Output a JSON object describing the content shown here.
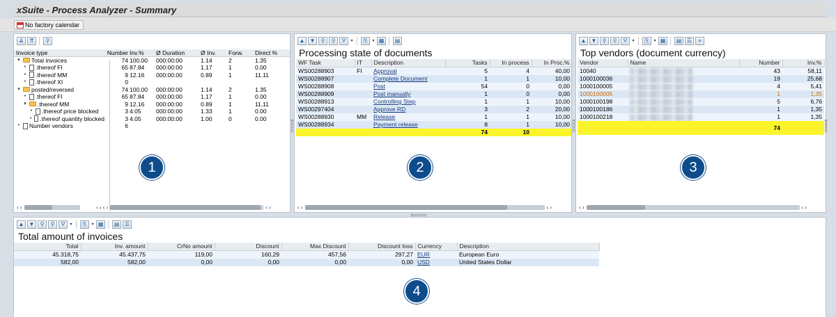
{
  "window": {
    "title": "xSuite - Process Analyzer - Summary"
  },
  "appbar": {
    "calendar_button": "No factory calendar"
  },
  "panel1": {
    "columns": [
      "Invoice type",
      "Number",
      "Inv.%",
      "Ø Duration",
      "Ø Inv.",
      "Forw.",
      "Direct %"
    ],
    "rows": [
      {
        "level": 0,
        "icon": "folder",
        "expand": "▾",
        "name": "Total invoices",
        "number": "74",
        "inv": "100.00",
        "duration": "000:00:00",
        "avg": "1.14",
        "forw": "2",
        "direct": "1.35"
      },
      {
        "level": 1,
        "icon": "doc",
        "expand": "•",
        "name": ".thereof FI",
        "number": "65",
        "inv": "87.84",
        "duration": "000:00:00",
        "avg": "1.17",
        "forw": "1",
        "direct": "0.00"
      },
      {
        "level": 1,
        "icon": "doc",
        "expand": "•",
        "name": ".thereof MM",
        "number": "9",
        "inv": "12.16",
        "duration": "000:00:00",
        "avg": "0.89",
        "forw": "1",
        "direct": "11.11"
      },
      {
        "level": 1,
        "icon": "doc",
        "expand": "•",
        "name": ".thereof XI",
        "number": "0",
        "inv": "",
        "duration": "",
        "avg": "",
        "forw": "",
        "direct": ""
      },
      {
        "level": 0,
        "icon": "folder",
        "expand": "▾",
        "name": "posted/reversed",
        "number": "74",
        "inv": "100.00",
        "duration": "000:00:00",
        "avg": "1.14",
        "forw": "2",
        "direct": "1.35"
      },
      {
        "level": 1,
        "icon": "doc",
        "expand": "•",
        "name": ".thereof FI",
        "number": "65",
        "inv": "87.84",
        "duration": "000:00:00",
        "avg": "1.17",
        "forw": "1",
        "direct": "0.00"
      },
      {
        "level": 1,
        "icon": "folder",
        "expand": "▾",
        "name": ".thereof MM",
        "number": "9",
        "inv": "12.16",
        "duration": "000:00:00",
        "avg": "0.89",
        "forw": "1",
        "direct": "11.11"
      },
      {
        "level": 2,
        "icon": "doc",
        "expand": "•",
        "name": ".thereof price blocked",
        "number": "3",
        "inv": "4.05",
        "duration": "000:00:00",
        "avg": "1.33",
        "forw": "1",
        "direct": "0.00"
      },
      {
        "level": 2,
        "icon": "doc",
        "expand": "•",
        "name": ".thereof quantity blocked",
        "number": "3",
        "inv": "4.05",
        "duration": "000:00:00",
        "avg": "1.00",
        "forw": "0",
        "direct": "0.00"
      },
      {
        "level": 0,
        "icon": "doc",
        "expand": "•",
        "name": "Number vendors",
        "number": "6",
        "inv": "",
        "duration": "",
        "avg": "",
        "forw": "",
        "direct": ""
      }
    ],
    "badge": "1"
  },
  "panel2": {
    "title": "Processing state of documents",
    "columns": [
      "WF Task",
      "IT",
      "Description",
      "Tasks",
      "In process",
      "In Proc.%"
    ],
    "rows": [
      {
        "task": "WS00288903",
        "it": "FI",
        "desc": "Approval",
        "tasks": "5",
        "inproc": "4",
        "pct": "40,00"
      },
      {
        "task": "WS00288907",
        "it": "",
        "desc": "Complete Document",
        "tasks": "1",
        "inproc": "1",
        "pct": "10,00"
      },
      {
        "task": "WS00288908",
        "it": "",
        "desc": "Post",
        "tasks": "54",
        "inproc": "0",
        "pct": "0,00"
      },
      {
        "task": "WS00288909",
        "it": "",
        "desc": "Post manually",
        "tasks": "1",
        "inproc": "0",
        "pct": "0,00"
      },
      {
        "task": "WS00288913",
        "it": "",
        "desc": "Controlling Step",
        "tasks": "1",
        "inproc": "1",
        "pct": "10,00"
      },
      {
        "task": "WS00297404",
        "it": "",
        "desc": "Approve RD",
        "tasks": "3",
        "inproc": "2",
        "pct": "20,00"
      },
      {
        "task": "WS00288930",
        "it": "MM",
        "desc": "Release",
        "tasks": "1",
        "inproc": "1",
        "pct": "10,00"
      },
      {
        "task": "WS00288934",
        "it": "",
        "desc": "Payment release",
        "tasks": "8",
        "inproc": "1",
        "pct": "10,00"
      }
    ],
    "sum": {
      "tasks": "74",
      "inproc": "10"
    },
    "badge": "2"
  },
  "panel3": {
    "title": "Top vendors (document currency)",
    "columns": [
      "Vendor",
      "Name",
      "Number",
      "Inv.%"
    ],
    "rows": [
      {
        "vendor": "10040",
        "number": "43",
        "pct": "58,11"
      },
      {
        "vendor": "1000100036",
        "number": "19",
        "pct": "25,68"
      },
      {
        "vendor": "1000100005",
        "number": "4",
        "pct": "5,41"
      },
      {
        "vendor": "1000100005",
        "number": "1",
        "pct": "1,35"
      },
      {
        "vendor": "1000100198",
        "number": "5",
        "pct": "6,76"
      },
      {
        "vendor": "1000100186",
        "number": "1",
        "pct": "1,35"
      },
      {
        "vendor": "1000100218",
        "number": "1",
        "pct": "1,35"
      }
    ],
    "sum": {
      "number": "74"
    },
    "highlight_color": "#c86a00",
    "badge": "3"
  },
  "panel4": {
    "title": "Total amount of invoices",
    "columns": [
      "Total",
      "Inv. amount",
      "CrNo amount",
      "Discount",
      "Max Discount",
      "Discount loss",
      "Currency",
      "Description"
    ],
    "rows": [
      {
        "total": "45.318,75",
        "inv": "45.437,75",
        "crno": "119,00",
        "disc": "160,29",
        "maxdisc": "457,56",
        "loss": "297,27",
        "cur": "EUR",
        "desc": "European Euro"
      },
      {
        "total": "582,00",
        "inv": "582,00",
        "crno": "0,00",
        "disc": "0,00",
        "maxdisc": "0,00",
        "loss": "0,00",
        "cur": "USD",
        "desc": "United States Dollar"
      }
    ],
    "badge": "4"
  },
  "colors": {
    "badge": "#0f4c8c",
    "sum_row": "#fbf42a",
    "row_odd": "#eef4fb",
    "row_even": "#dbe7f4"
  }
}
